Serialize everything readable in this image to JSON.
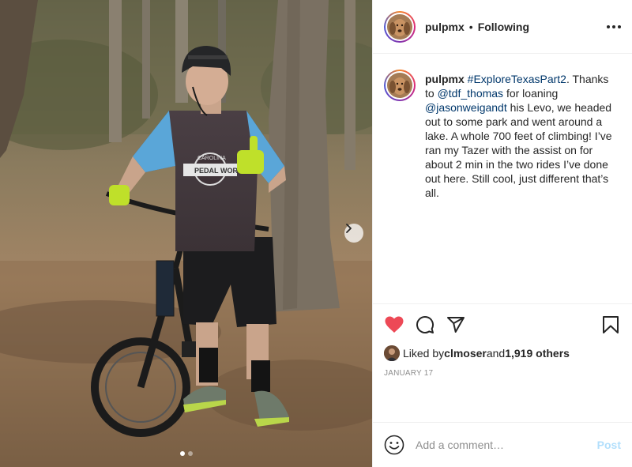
{
  "post": {
    "username": "pulpmx",
    "separator": "•",
    "follow_status": "Following",
    "more_icon": "more-horizontal-icon"
  },
  "caption": {
    "username": "pulpmx",
    "hashtag": "#ExploreTexasPart2",
    "text1": ". Thanks to ",
    "mention1": "@tdf_thomas",
    "text2": " for loaning ",
    "mention2": "@jasonweigandt",
    "text3": " his Levo, we headed out to some park and went around a lake. A whole 700 feet of climbing! I’ve ran my Tazer with the assist on for about 2 min in the two rides I’ve done out here. Still cool, just different that’s all."
  },
  "photo": {
    "jersey_text_top": "CAROLINA",
    "jersey_text_left": "PEDAL",
    "jersey_text_right": "WORKS",
    "carousel_total": 2,
    "carousel_active": 1
  },
  "actions": {
    "liked": true,
    "like_color": "#ed4956",
    "like_icon": "heart-icon",
    "comment_icon": "comment-icon",
    "share_icon": "share-icon",
    "save_icon": "bookmark-icon"
  },
  "likes": {
    "prefix": "Liked by ",
    "user": "clmoser",
    "middle": " and ",
    "others": "1,919 others"
  },
  "date": "JANUARY 17",
  "comment": {
    "placeholder": "Add a comment…",
    "post_label": "Post",
    "post_color": "#b2dffc"
  }
}
